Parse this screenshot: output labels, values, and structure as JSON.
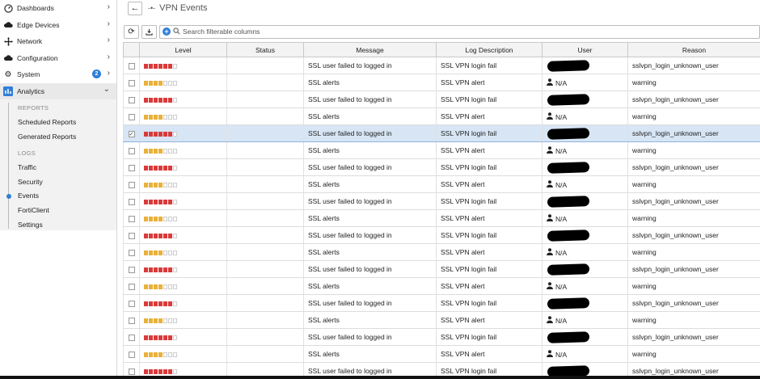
{
  "sidebar": {
    "items": [
      {
        "label": "Dashboards",
        "icon": "dashboard-icon"
      },
      {
        "label": "Edge Devices",
        "icon": "cloud-icon"
      },
      {
        "label": "Network",
        "icon": "network-icon"
      },
      {
        "label": "Configuration",
        "icon": "cloud-icon"
      },
      {
        "label": "System",
        "icon": "gear-icon",
        "badge": "2"
      },
      {
        "label": "Analytics",
        "icon": "analytics-icon"
      }
    ],
    "analytics": {
      "reports_header": "REPORTS",
      "reports": [
        "Scheduled Reports",
        "Generated Reports"
      ],
      "logs_header": "LOGS",
      "logs": [
        "Traffic",
        "Security",
        "Events",
        "FortiClient",
        "Settings"
      ],
      "current": "Events"
    }
  },
  "header": {
    "title": "VPN Events",
    "back_icon": "arrow-left-icon"
  },
  "toolbar": {
    "search_placeholder": "Search filterable columns"
  },
  "table": {
    "columns": [
      "",
      "Level",
      "Status",
      "Message",
      "Log Description",
      "User",
      "Reason"
    ],
    "level_colors": {
      "high": "#d93a3a",
      "medium": "#e8b13a",
      "empty": "#e4e4e4"
    },
    "rows": [
      {
        "level": 6,
        "message": "SSL user failed to logged in",
        "desc": "SSL VPN login fail",
        "user": null,
        "reason": "sslvpn_login_unknown_user"
      },
      {
        "level": 4,
        "message": "SSL alerts",
        "desc": "SSL VPN alert",
        "user": "N/A",
        "reason": "warning"
      },
      {
        "level": 6,
        "message": "SSL user failed to logged in",
        "desc": "SSL VPN login fail",
        "user": null,
        "reason": "sslvpn_login_unknown_user"
      },
      {
        "level": 4,
        "message": "SSL alerts",
        "desc": "SSL VPN alert",
        "user": "N/A",
        "reason": "warning"
      },
      {
        "level": 6,
        "message": "SSL user failed to logged in",
        "desc": "SSL VPN login fail",
        "user": null,
        "reason": "sslvpn_login_unknown_user",
        "selected": true
      },
      {
        "level": 4,
        "message": "SSL alerts",
        "desc": "SSL VPN alert",
        "user": "N/A",
        "reason": "warning"
      },
      {
        "level": 6,
        "message": "SSL user failed to logged in",
        "desc": "SSL VPN login fail",
        "user": null,
        "reason": "sslvpn_login_unknown_user"
      },
      {
        "level": 4,
        "message": "SSL alerts",
        "desc": "SSL VPN alert",
        "user": "N/A",
        "reason": "warning"
      },
      {
        "level": 6,
        "message": "SSL user failed to logged in",
        "desc": "SSL VPN login fail",
        "user": null,
        "reason": "sslvpn_login_unknown_user"
      },
      {
        "level": 4,
        "message": "SSL alerts",
        "desc": "SSL VPN alert",
        "user": "N/A",
        "reason": "warning"
      },
      {
        "level": 6,
        "message": "SSL user failed to logged in",
        "desc": "SSL VPN login fail",
        "user": null,
        "reason": "sslvpn_login_unknown_user"
      },
      {
        "level": 4,
        "message": "SSL alerts",
        "desc": "SSL VPN alert",
        "user": "N/A",
        "reason": "warning"
      },
      {
        "level": 6,
        "message": "SSL user failed to logged in",
        "desc": "SSL VPN login fail",
        "user": null,
        "reason": "sslvpn_login_unknown_user"
      },
      {
        "level": 4,
        "message": "SSL alerts",
        "desc": "SSL VPN alert",
        "user": "N/A",
        "reason": "warning"
      },
      {
        "level": 6,
        "message": "SSL user failed to logged in",
        "desc": "SSL VPN login fail",
        "user": null,
        "reason": "sslvpn_login_unknown_user"
      },
      {
        "level": 4,
        "message": "SSL alerts",
        "desc": "SSL VPN alert",
        "user": "N/A",
        "reason": "warning"
      },
      {
        "level": 6,
        "message": "SSL user failed to logged in",
        "desc": "SSL VPN login fail",
        "user": null,
        "reason": "sslvpn_login_unknown_user"
      },
      {
        "level": 4,
        "message": "SSL alerts",
        "desc": "SSL VPN alert",
        "user": "N/A",
        "reason": "warning"
      },
      {
        "level": 6,
        "message": "SSL user failed to logged in",
        "desc": "SSL VPN login fail",
        "user": null,
        "reason": "sslvpn_login_unknown_user"
      }
    ]
  }
}
